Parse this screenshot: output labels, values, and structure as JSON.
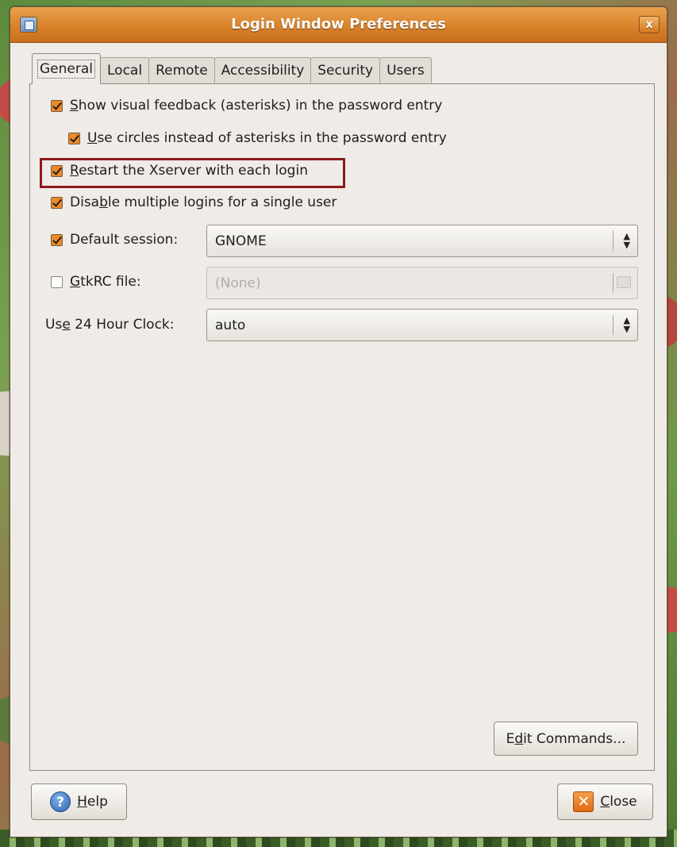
{
  "window": {
    "title": "Login Window Preferences",
    "close_glyph": "x"
  },
  "tabs": [
    {
      "label": "General",
      "active": true
    },
    {
      "label": "Local"
    },
    {
      "label": "Remote"
    },
    {
      "label": "Accessibility"
    },
    {
      "label": "Security"
    },
    {
      "label": "Users"
    }
  ],
  "general": {
    "show_feedback": {
      "mnemonic": "S",
      "rest": "how visual feedback (asterisks) in the password entry",
      "checked": true
    },
    "use_circles": {
      "mnemonic": "U",
      "rest": "se circles instead of asterisks in the password entry",
      "checked": true
    },
    "restart_xserver": {
      "mnemonic": "R",
      "rest": "estart the Xserver with each login",
      "checked": true
    },
    "disable_multiple": {
      "pre": "Disa",
      "mnemonic": "b",
      "rest": "le multiple logins for a single user",
      "checked": true
    },
    "default_session": {
      "label": "Default session:",
      "checked": true,
      "value": "GNOME"
    },
    "gtkrc": {
      "mnemonic": "G",
      "rest": "tkRC file:",
      "checked": false,
      "value": "(None)"
    },
    "clock": {
      "pre": "Us",
      "mnemonic": "e",
      "rest": " 24 Hour Clock:",
      "value": "auto"
    },
    "edit_commands": {
      "pre": "E",
      "mnemonic": "d",
      "rest": "it Commands..."
    }
  },
  "footer": {
    "help": {
      "mnemonic": "H",
      "rest": "elp"
    },
    "close": {
      "mnemonic": "C",
      "rest": "lose"
    }
  },
  "icons": {
    "help_glyph": "?",
    "close_glyph": "✕",
    "combo_arrows": "▲▼"
  },
  "colors": {
    "titlebar": "#d9822a",
    "checkbox": "#e88b2b",
    "highlight": "#8b1a1a"
  }
}
